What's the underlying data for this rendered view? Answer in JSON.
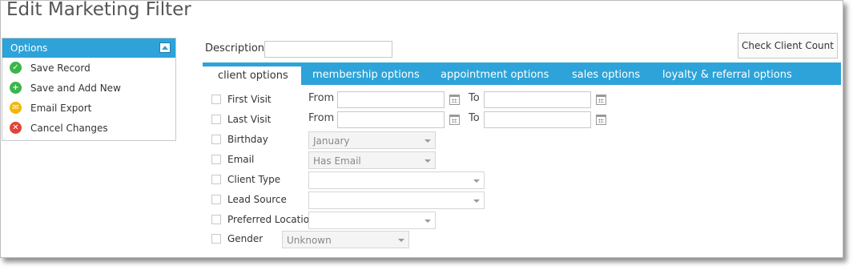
{
  "page": {
    "title": "Edit Marketing Filter"
  },
  "options": {
    "header": "Options",
    "items": [
      {
        "label": "Save Record",
        "icon": "check-icon",
        "color": "#3cb54a"
      },
      {
        "label": "Save and Add New",
        "icon": "plus-icon",
        "color": "#3cb54a"
      },
      {
        "label": "Email Export",
        "icon": "email-icon",
        "color": "#f2b705"
      },
      {
        "label": "Cancel Changes",
        "icon": "cancel-icon",
        "color": "#e0443a"
      }
    ]
  },
  "description": {
    "label": "Description",
    "value": ""
  },
  "check_client_count": {
    "label": "Check Client Count"
  },
  "tabs": [
    {
      "label": "client options",
      "active": true
    },
    {
      "label": "membership options",
      "active": false
    },
    {
      "label": "appointment options",
      "active": false
    },
    {
      "label": "sales options",
      "active": false
    },
    {
      "label": "loyalty & referral options",
      "active": false
    }
  ],
  "filters": {
    "from_label": "From",
    "to_label": "To",
    "first_visit": {
      "label": "First Visit",
      "from": "",
      "to": ""
    },
    "last_visit": {
      "label": "Last Visit",
      "from": "",
      "to": ""
    },
    "birthday": {
      "label": "Birthday",
      "value": "January"
    },
    "email": {
      "label": "Email",
      "value": "Has Email"
    },
    "client_type": {
      "label": "Client Type",
      "value": ""
    },
    "lead_source": {
      "label": "Lead Source",
      "value": ""
    },
    "preferred_location": {
      "label": "Preferred Location",
      "value": ""
    },
    "gender": {
      "label": "Gender",
      "value": "Unknown"
    }
  },
  "colors": {
    "accent": "#2da3d9"
  }
}
